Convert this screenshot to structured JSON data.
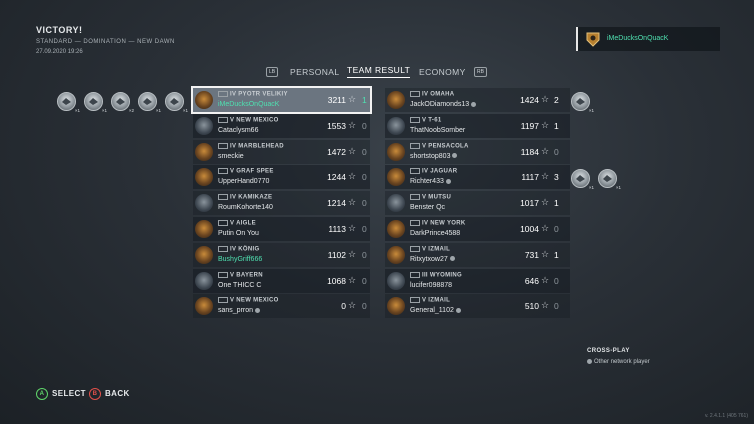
{
  "header": {
    "title": "VICTORY!",
    "subtitle": "STANDARD — DOMINATION — NEW DAWN",
    "date": "27.09.2020 19:26"
  },
  "player_card": {
    "name": "iMeDucksOnQuacK",
    "icon": "player-emblem-icon"
  },
  "tabs": {
    "lb": "LB",
    "rb": "RB",
    "items": [
      {
        "label": "PERSONAL",
        "active": false
      },
      {
        "label": "TEAM RESULT",
        "active": true
      },
      {
        "label": "ECONOMY",
        "active": false
      }
    ]
  },
  "left_medals": [
    {
      "count": "×1"
    },
    {
      "count": "×1"
    },
    {
      "count": "×2"
    },
    {
      "count": "×1"
    },
    {
      "count": "×1"
    }
  ],
  "left_team": [
    {
      "tier": "IV",
      "ship": "PYOTR VELIKIY",
      "player": "iMeDucksOnQuacK",
      "score": "3211",
      "kills": "1",
      "highlight": true,
      "green_name": true,
      "dot": false
    },
    {
      "tier": "V",
      "ship": "NEW MEXICO",
      "player": "Cataclysm66",
      "score": "1553",
      "kills": "0",
      "dot": false
    },
    {
      "tier": "IV",
      "ship": "MARBLEHEAD",
      "player": "smeckie",
      "score": "1472",
      "kills": "0",
      "dot": false
    },
    {
      "tier": "V",
      "ship": "GRAF SPEE",
      "player": "UpperHand0770",
      "score": "1244",
      "kills": "0",
      "dot": false
    },
    {
      "tier": "IV",
      "ship": "KAMIKAZE",
      "player": "RoumKohorte140",
      "score": "1214",
      "kills": "0",
      "dot": false
    },
    {
      "tier": "V",
      "ship": "AIGLE",
      "player": "Putin On You",
      "score": "1113",
      "kills": "0",
      "dot": false
    },
    {
      "tier": "IV",
      "ship": "KÖNIG",
      "player": "BushyGriff666",
      "score": "1102",
      "kills": "0",
      "green_name": true,
      "dot": false
    },
    {
      "tier": "V",
      "ship": "BAYERN",
      "player": "One THICC C",
      "score": "1068",
      "kills": "0",
      "dot": false
    },
    {
      "tier": "V",
      "ship": "NEW MEXICO",
      "player": "sans_prron",
      "score": "0",
      "kills": "0",
      "dot": true
    }
  ],
  "right_team": [
    {
      "tier": "IV",
      "ship": "OMAHA",
      "player": "JackODiamonds13",
      "score": "1424",
      "kills": "2",
      "dot": true,
      "medals": [
        "×1"
      ]
    },
    {
      "tier": "V",
      "ship": "T-61",
      "player": "ThatNoobSomber",
      "score": "1197",
      "kills": "1",
      "dot": false,
      "medals": []
    },
    {
      "tier": "V",
      "ship": "PENSACOLA",
      "player": "shortstop803",
      "score": "1184",
      "kills": "0",
      "dot": true,
      "medals": []
    },
    {
      "tier": "IV",
      "ship": "JAGUAR",
      "player": "Richter433",
      "score": "1117",
      "kills": "3",
      "dot": true,
      "medals": [
        "×1",
        "×1"
      ]
    },
    {
      "tier": "V",
      "ship": "MUTSU",
      "player": "Benster Qc",
      "score": "1017",
      "kills": "1",
      "dot": false,
      "medals": []
    },
    {
      "tier": "IV",
      "ship": "NEW YORK",
      "player": "DarkPrince4588",
      "score": "1004",
      "kills": "0",
      "dot": false,
      "medals": []
    },
    {
      "tier": "V",
      "ship": "IZMAIL",
      "player": "Ritxytxow27",
      "score": "731",
      "kills": "1",
      "dot": true,
      "medals": []
    },
    {
      "tier": "III",
      "ship": "WYOMING",
      "player": "lucifer098878",
      "score": "646",
      "kills": "0",
      "dot": false,
      "medals": []
    },
    {
      "tier": "V",
      "ship": "IZMAIL",
      "player": "General_1102",
      "score": "510",
      "kills": "0",
      "dot": true,
      "medals": []
    }
  ],
  "crossplay": {
    "heading": "CROSS-PLAY",
    "text": "Other network player"
  },
  "controls": {
    "select_btn": "A",
    "select_label": "SELECT",
    "back_btn": "B",
    "back_label": "BACK"
  },
  "version": "v. 2.4.1.1 (405 761)",
  "colors": {
    "accent_green": "#4fe0b0",
    "highlight": "#6b7580"
  }
}
